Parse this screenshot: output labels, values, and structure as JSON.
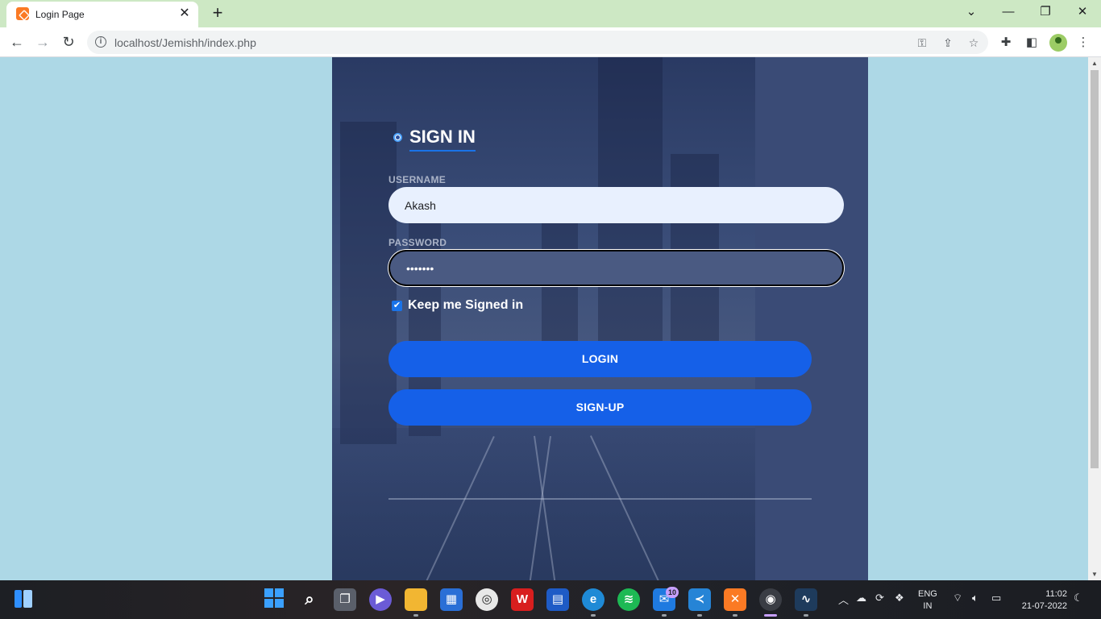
{
  "browser": {
    "tab_title": "Login Page",
    "tab_close": "✕",
    "new_tab": "+",
    "url": "localhost/Jemishh/index.php",
    "window_controls": {
      "chevron": "⌄",
      "minimize": "—",
      "restore": "❐",
      "close": "✕"
    },
    "nav": {
      "back": "←",
      "forward": "→",
      "reload": "↻"
    },
    "omnibox_icons": {
      "info": "i",
      "key": "⚿",
      "share": "⇪",
      "star": "☆"
    },
    "toolbar_icons": {
      "extensions": "✚",
      "sidepanel": "◧",
      "menu": "⋮"
    }
  },
  "login": {
    "title": "SIGN IN",
    "username_label": "USERNAME",
    "username_value": "Akash",
    "password_label": "PASSWORD",
    "password_value": "•••••••",
    "keep_signed_in": "Keep me Signed in",
    "keep_signed_in_checked": true,
    "login_button": "LOGIN",
    "signup_button": "SIGN-UP"
  },
  "taskbar": {
    "mail_badge": "10",
    "language": [
      "ENG",
      "IN"
    ],
    "time": "11:02",
    "date": "21-07-2022"
  },
  "colors": {
    "page_background": "#add8e6",
    "card_background": "#2e4474",
    "accent_button": "#1560e8",
    "tab_strip": "#cde8c4"
  }
}
